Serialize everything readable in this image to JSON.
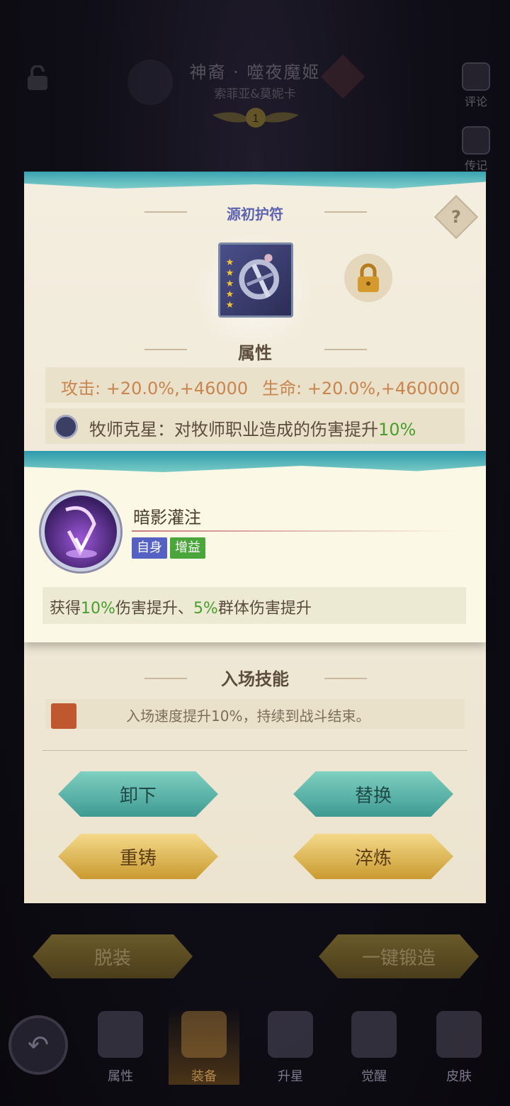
{
  "header": {
    "hero_title": "神裔 · 噬夜魔姬",
    "hero_subtitle": "索菲亚&莫妮卡",
    "star_level": "1",
    "side_buttons": [
      {
        "label": "评论",
        "icon": "thumbs-up-icon"
      },
      {
        "label": "传记",
        "icon": "book-icon"
      }
    ]
  },
  "modal": {
    "title": "源初护符",
    "help_label": "?",
    "item_stars": "★★★★★",
    "attributes_title": "属性",
    "attack_text": "攻击: +20.0%,+46000",
    "hp_text": "生命: +20.0%,+460000",
    "counter_prefix": "牧师克星：对牧师职业造成的伤害提升",
    "counter_value": "10%",
    "entry_title": "入场技能",
    "entry_text": "入场速度提升10%，持续到战斗结束。",
    "buttons": {
      "unequip": "卸下",
      "replace": "替换",
      "recast": "重铸",
      "refine": "淬炼"
    }
  },
  "popup": {
    "skill_name": "暗影灌注",
    "tags": [
      "自身",
      "增益"
    ],
    "desc": [
      {
        "text": "获得",
        "green": false
      },
      {
        "text": "10%",
        "green": true
      },
      {
        "text": "伤害提升、",
        "green": false
      },
      {
        "text": "5%",
        "green": true
      },
      {
        "text": "群体伤害提升",
        "green": false
      }
    ]
  },
  "footer": {
    "unequip_all": "脱装",
    "one_click_forge": "一键锻造",
    "nav": [
      "属性",
      "装备",
      "升星",
      "觉醒",
      "皮肤"
    ],
    "active_nav": "装备"
  },
  "colors": {
    "accent_teal": "#3aa3b0",
    "gold": "#c99a30",
    "green_value": "#4a9e2c",
    "attr_orange": "#c98550"
  }
}
